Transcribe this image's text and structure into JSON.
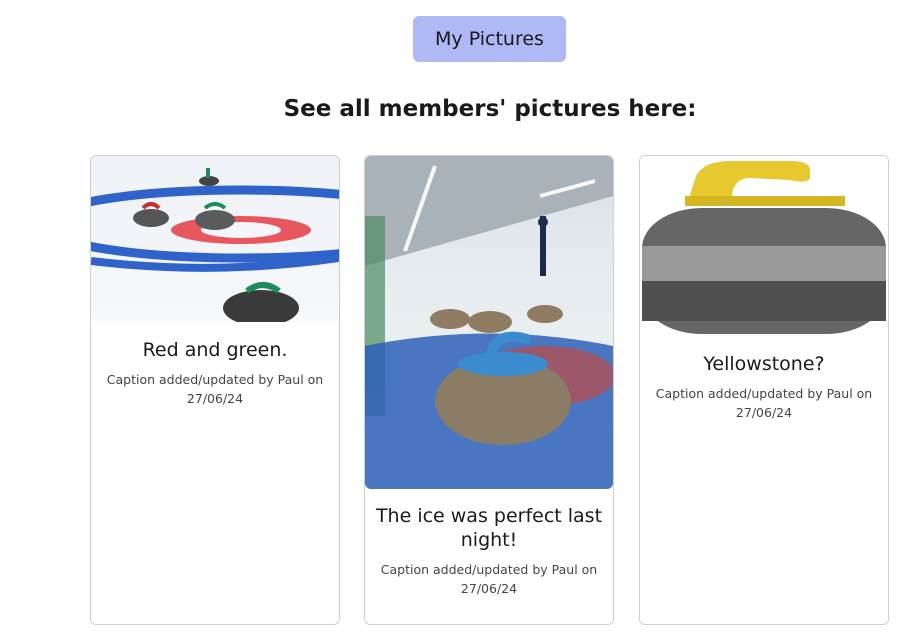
{
  "header": {
    "my_pictures_label": "My Pictures"
  },
  "main": {
    "heading": "See all members' pictures here:",
    "cards": [
      {
        "caption": "Red and green.",
        "meta": "Caption added/updated by Paul on 27/06/24",
        "image": "curling-stones-on-house-photo"
      },
      {
        "caption": "The ice was perfect last night!",
        "meta": "Caption added/updated by Paul on 27/06/24",
        "image": "curling-rink-photo"
      },
      {
        "caption": "Yellowstone?",
        "meta": "Caption added/updated by Paul on 27/06/24",
        "image": "yellow-handle-curling-stone-photo"
      }
    ]
  }
}
